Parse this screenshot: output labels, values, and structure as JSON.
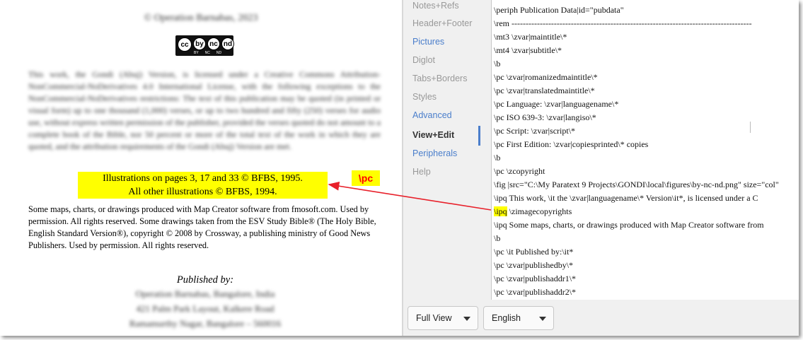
{
  "preview": {
    "copyright_line": "© Operation Barnabas, 2023",
    "cc_badge": {
      "icons": [
        "cc",
        "by",
        "nc",
        "nd"
      ],
      "labels": [
        "BY",
        "NC",
        "ND"
      ]
    },
    "license_text": "This work, the Gondi (Abuj) Version, is licensed under a Creative Commons Attribution-NonCommercial-NoDerivatives 4.0 International License, with the following exceptions to the NonCommercial-NoDerivatives restrictions: The text of this publication may be quoted (in printed or visual form) up to one thousand (1,000) verses, or up to two hundred and fifty (250) verses for audio use, without express written permission of the publisher, provided the verses quoted do not amount to a complete book of the Bible, nor 50 percent or more of the total text of the work in which they are quoted, and the attribution requirements of the Gondi (Abuj) Version are met.",
    "illustrations_line1": "Illustrations on pages 3, 17 and 33 © BFBS, 1995.",
    "illustrations_line2": "All other illustrations © BFBS, 1994.",
    "pc_tag": "\\pc",
    "maps_text": "Some maps, charts, or drawings produced with Map Creator software from fmosoft.com. Used by permission. All rights reserved. Some drawings taken from the ESV Study Bible® (The Holy Bible, English Standard Version®), copyright © 2008 by Crossway, a publishing ministry of Good News Publishers. Used by permission. All rights reserved.",
    "published_by": "Published by:",
    "publisher_lines": [
      "Operation Barnabas, Bangalore, India",
      "421 Palm Park Layout, Kalkere Road",
      "Ramamurthy Nagar, Bangalore – 560016"
    ]
  },
  "sidebar": {
    "tabs": [
      {
        "label": "Notes+Refs",
        "state": "dim"
      },
      {
        "label": "Header+Footer",
        "state": "dim"
      },
      {
        "label": "Pictures",
        "state": "link"
      },
      {
        "label": "Diglot",
        "state": "dim"
      },
      {
        "label": "Tabs+Borders",
        "state": "dim"
      },
      {
        "label": "Styles",
        "state": "dim"
      },
      {
        "label": "Advanced",
        "state": "link"
      },
      {
        "label": "View+Edit",
        "state": "active"
      },
      {
        "label": "Peripherals",
        "state": "link"
      },
      {
        "label": "Help",
        "state": "dim"
      }
    ]
  },
  "editor": {
    "lines": [
      "\\periph Publication Data|id=\"pubdata\"",
      "\\rem -------------------------------------------------------------------------------------",
      "\\mt3 \\zvar|maintitle\\*",
      "\\mt4 \\zvar|subtitle\\*",
      "\\b",
      "\\pc \\zvar|romanizedmaintitle\\*",
      "\\pc \\zvar|translatedmaintitle\\*",
      "\\pc Language: \\zvar|languagename\\*",
      "\\pc ISO 639-3: \\zvar|langiso\\*",
      "\\pc Script: \\zvar|script\\*",
      "\\pc First Edition: \\zvar|copiesprinted\\* copies",
      "\\b",
      "\\pc \\zcopyright",
      "\\fig |src=\"C:\\My Paratext 9 Projects\\GONDI\\local\\figures\\by-nc-nd.png\" size=\"col\"",
      "\\ipq This work, \\it the \\zvar|languagename\\* Version\\it*, is licensed under a C",
      "\\zimagecopyrights",
      "\\ipq Some maps, charts, or drawings produced with Map Creator software from",
      "\\b",
      "\\pc \\it Published by:\\it*",
      "\\pc \\zvar|publishedby\\*",
      "\\pc \\zvar|publishaddr1\\*",
      "\\pc \\zvar|publishaddr2\\*"
    ],
    "highlight_marker": "\\ipq"
  },
  "bottombar": {
    "view_select": "Full View",
    "language_select": "English"
  },
  "colors": {
    "highlight": "#ffff00",
    "arrow": "#e8202a",
    "link_tab": "#4a7ecb",
    "dim_tab": "#999999"
  }
}
